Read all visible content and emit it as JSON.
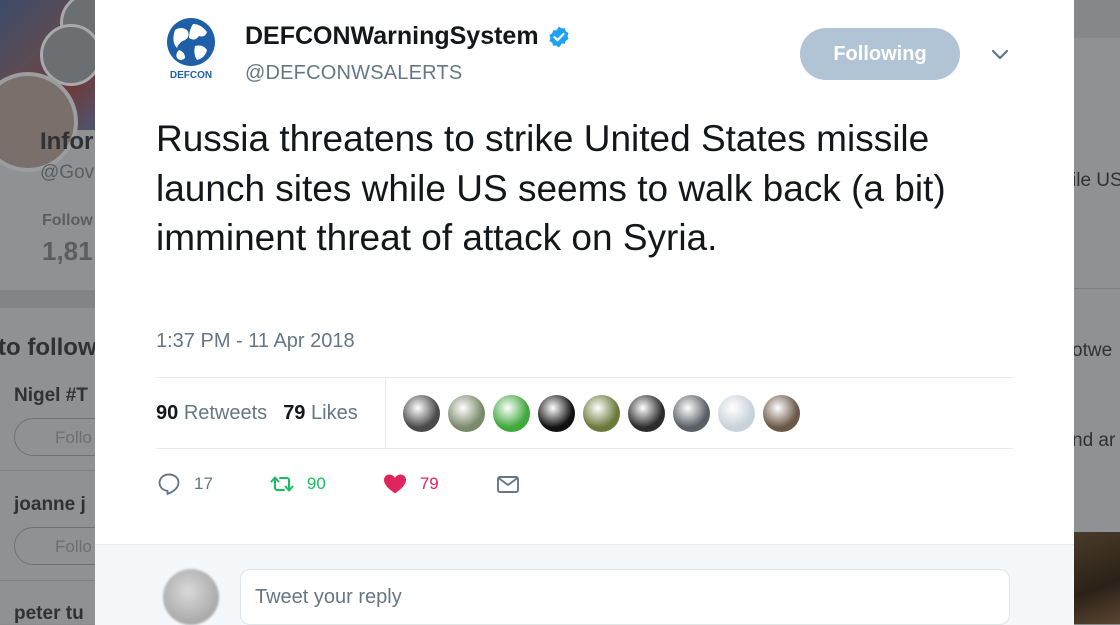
{
  "background": {
    "left": {
      "profile_name": "Infor",
      "profile_handle": "@Gov",
      "following_label": "Follow",
      "following_count": "1,81",
      "who_to_follow": "to follow",
      "suggestions": [
        {
          "name": "Nigel #T",
          "button": "Follo"
        },
        {
          "name": "joanne j",
          "button": "Follo"
        },
        {
          "name": "peter tu",
          "button": ""
        }
      ]
    },
    "right": {
      "snippets": [
        "ile US",
        "otwe",
        "nd ar"
      ]
    }
  },
  "tweet": {
    "author": {
      "display_name": "DEFCONWarningSystem",
      "handle": "@DEFCONWSALERTS",
      "avatar_label": "DEFCON",
      "verified": true
    },
    "follow_button": "Following",
    "text": "Russia threatens to strike United States missile launch sites while US seems to walk back (a bit) imminent threat of attack on Syria.",
    "timestamp": "1:37 PM - 11 Apr 2018",
    "stats": {
      "retweets_count": "90",
      "retweets_label": "Retweets",
      "likes_count": "79",
      "likes_label": "Likes"
    },
    "liker_avatars": [
      "#4a4a4a",
      "#7a8a6a",
      "#3fa83a",
      "#111111",
      "#6b7a3a",
      "#2b2b2b",
      "#5a5f66",
      "#c9d2da",
      "#6b5848"
    ],
    "actions": {
      "reply_count": "17",
      "retweet_count": "90",
      "like_count": "79"
    },
    "colors": {
      "reply": "#657786",
      "retweet": "#17bf63",
      "like": "#e0245e",
      "dm": "#657786",
      "verified": "#1da1f2"
    }
  },
  "reply": {
    "placeholder": "Tweet your reply"
  }
}
